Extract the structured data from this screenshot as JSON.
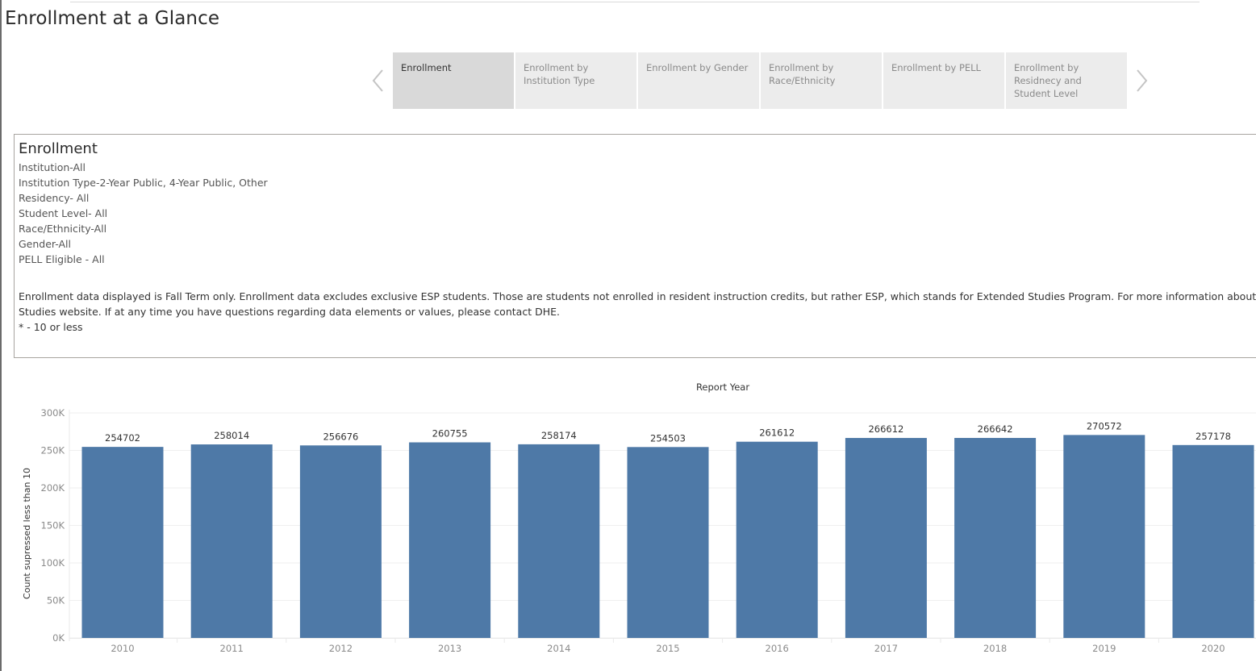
{
  "page": {
    "title": "Enrollment at a Glance"
  },
  "navigator": {
    "prev_icon": "chevron-left-icon",
    "next_icon": "chevron-right-icon",
    "tabs": [
      {
        "label": "Enrollment",
        "active": true
      },
      {
        "label": "Enrollment by Institution Type",
        "active": false
      },
      {
        "label": "Enrollment by Gender",
        "active": false
      },
      {
        "label": "Enrollment by Race/Ethnicity",
        "active": false
      },
      {
        "label": "Enrollment by PELL",
        "active": false
      },
      {
        "label": "Enrollment by Residnecy and Student Level",
        "active": false
      }
    ]
  },
  "info": {
    "heading": "Enrollment",
    "filters": [
      "Institution-All",
      "Institution Type-2-Year Public, 4-Year Public, Other",
      "Residency- All",
      "Student Level- All",
      "Race/Ethnicity-All",
      "Gender-All",
      "PELL Eligible - All"
    ],
    "note_lines": [
      "Enrollment data displayed is Fall Term only. Enrollment data excludes exclusive ESP students. Those are students not enrolled in resident instruction credits, but rather ESP, which stands for Extended Studies Program. For more information about ESP, v",
      "Studies website. If at any time you have questions regarding data elements or values, please contact DHE.",
      "* - 10 or less"
    ]
  },
  "colors": {
    "bar": "#4e79a7",
    "grid": "#efefef",
    "tab_active": "#d9d9d9",
    "tab_inactive": "#ececec"
  },
  "chart_data": {
    "type": "bar",
    "title": "Report Year",
    "xlabel": "",
    "ylabel": "Count supressed less than 10",
    "categories": [
      "2010",
      "2011",
      "2012",
      "2013",
      "2014",
      "2015",
      "2016",
      "2017",
      "2018",
      "2019",
      "2020"
    ],
    "values": [
      254702,
      258014,
      256676,
      260755,
      258174,
      254503,
      261612,
      266612,
      266642,
      270572,
      257178
    ],
    "ylim": [
      0,
      300000
    ],
    "yticks": [
      0,
      50000,
      100000,
      150000,
      200000,
      250000,
      300000
    ],
    "ytick_labels": [
      "0K",
      "50K",
      "100K",
      "150K",
      "200K",
      "250K",
      "300K"
    ],
    "grid": true,
    "data_labels": true,
    "legend": "none"
  }
}
